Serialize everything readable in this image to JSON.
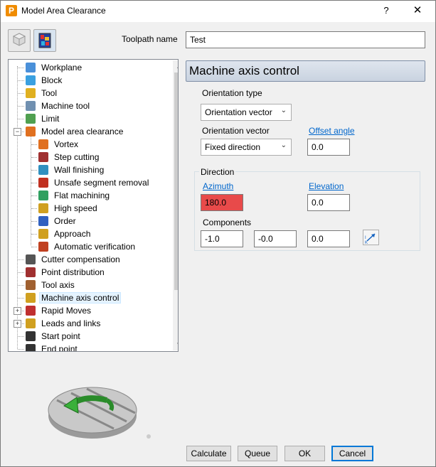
{
  "window": {
    "title": "Model Area Clearance",
    "help": "?",
    "close": "✕",
    "app_icon_letter": "P"
  },
  "toolpath_name": {
    "label": "Toolpath name",
    "value": "Test"
  },
  "tree": {
    "items": [
      {
        "label": "Workplane",
        "level": 0,
        "icon": "workplane-icon",
        "color": "#4a90d9"
      },
      {
        "label": "Block",
        "level": 0,
        "icon": "block-icon",
        "color": "#3aa0e0"
      },
      {
        "label": "Tool",
        "level": 0,
        "icon": "tool-icon",
        "color": "#e0b020"
      },
      {
        "label": "Machine tool",
        "level": 0,
        "icon": "machine-tool-icon",
        "color": "#7090b0"
      },
      {
        "label": "Limit",
        "level": 0,
        "icon": "limit-icon",
        "color": "#50a050"
      },
      {
        "label": "Model area clearance",
        "level": 0,
        "icon": "model-area-clearance-icon",
        "color": "#e07020",
        "expander": "−"
      },
      {
        "label": "Vortex",
        "level": 1,
        "icon": "vortex-icon",
        "color": "#e07020"
      },
      {
        "label": "Step cutting",
        "level": 1,
        "icon": "step-cutting-icon",
        "color": "#a03030"
      },
      {
        "label": "Wall finishing",
        "level": 1,
        "icon": "wall-finishing-icon",
        "color": "#3090c0"
      },
      {
        "label": "Unsafe segment removal",
        "level": 1,
        "icon": "unsafe-segment-removal-icon",
        "color": "#c03020"
      },
      {
        "label": "Flat machining",
        "level": 1,
        "icon": "flat-machining-icon",
        "color": "#30a060"
      },
      {
        "label": "High speed",
        "level": 1,
        "icon": "high-speed-icon",
        "color": "#d0a020"
      },
      {
        "label": "Order",
        "level": 1,
        "icon": "order-icon",
        "color": "#3060c0"
      },
      {
        "label": "Approach",
        "level": 1,
        "icon": "approach-icon",
        "color": "#d0a020"
      },
      {
        "label": "Automatic verification",
        "level": 1,
        "icon": "automatic-verification-icon",
        "color": "#c04020"
      },
      {
        "label": "Cutter compensation",
        "level": 0,
        "icon": "cutter-compensation-icon",
        "color": "#555555"
      },
      {
        "label": "Point distribution",
        "level": 0,
        "icon": "point-distribution-icon",
        "color": "#a03030"
      },
      {
        "label": "Tool axis",
        "level": 0,
        "icon": "tool-axis-icon",
        "color": "#a06030"
      },
      {
        "label": "Machine axis control",
        "level": 0,
        "icon": "machine-axis-control-icon",
        "color": "#d0a020",
        "selected": true
      },
      {
        "label": "Rapid Moves",
        "level": 0,
        "icon": "rapid-moves-icon",
        "color": "#c03030",
        "expander": "+"
      },
      {
        "label": "Leads and links",
        "level": 0,
        "icon": "leads-and-links-icon",
        "color": "#d0a020",
        "expander": "+"
      },
      {
        "label": "Start point",
        "level": 0,
        "icon": "start-point-icon",
        "color": "#333333"
      },
      {
        "label": "End point",
        "level": 0,
        "icon": "end-point-icon",
        "color": "#333333"
      }
    ]
  },
  "panel": {
    "title": "Machine axis control",
    "orientation_type": {
      "label": "Orientation type",
      "value": "Orientation vector"
    },
    "orientation_vector": {
      "label": "Orientation vector",
      "value": "Fixed direction"
    },
    "offset_angle": {
      "label": "Offset angle",
      "value": "0.0"
    },
    "direction": {
      "label": "Direction",
      "azimuth_label": "Azimuth",
      "azimuth_value": "180.0",
      "elevation_label": "Elevation",
      "elevation_value": "0.0",
      "components_label": "Components",
      "components": [
        "-1.0",
        "-0.0",
        "0.0"
      ]
    }
  },
  "buttons": {
    "calculate": "Calculate",
    "queue": "Queue",
    "ok": "OK",
    "cancel": "Cancel"
  },
  "colors": {
    "azimuth_highlight": "#e84a4a",
    "link": "#0066cc",
    "selection": "#e5f3ff"
  }
}
